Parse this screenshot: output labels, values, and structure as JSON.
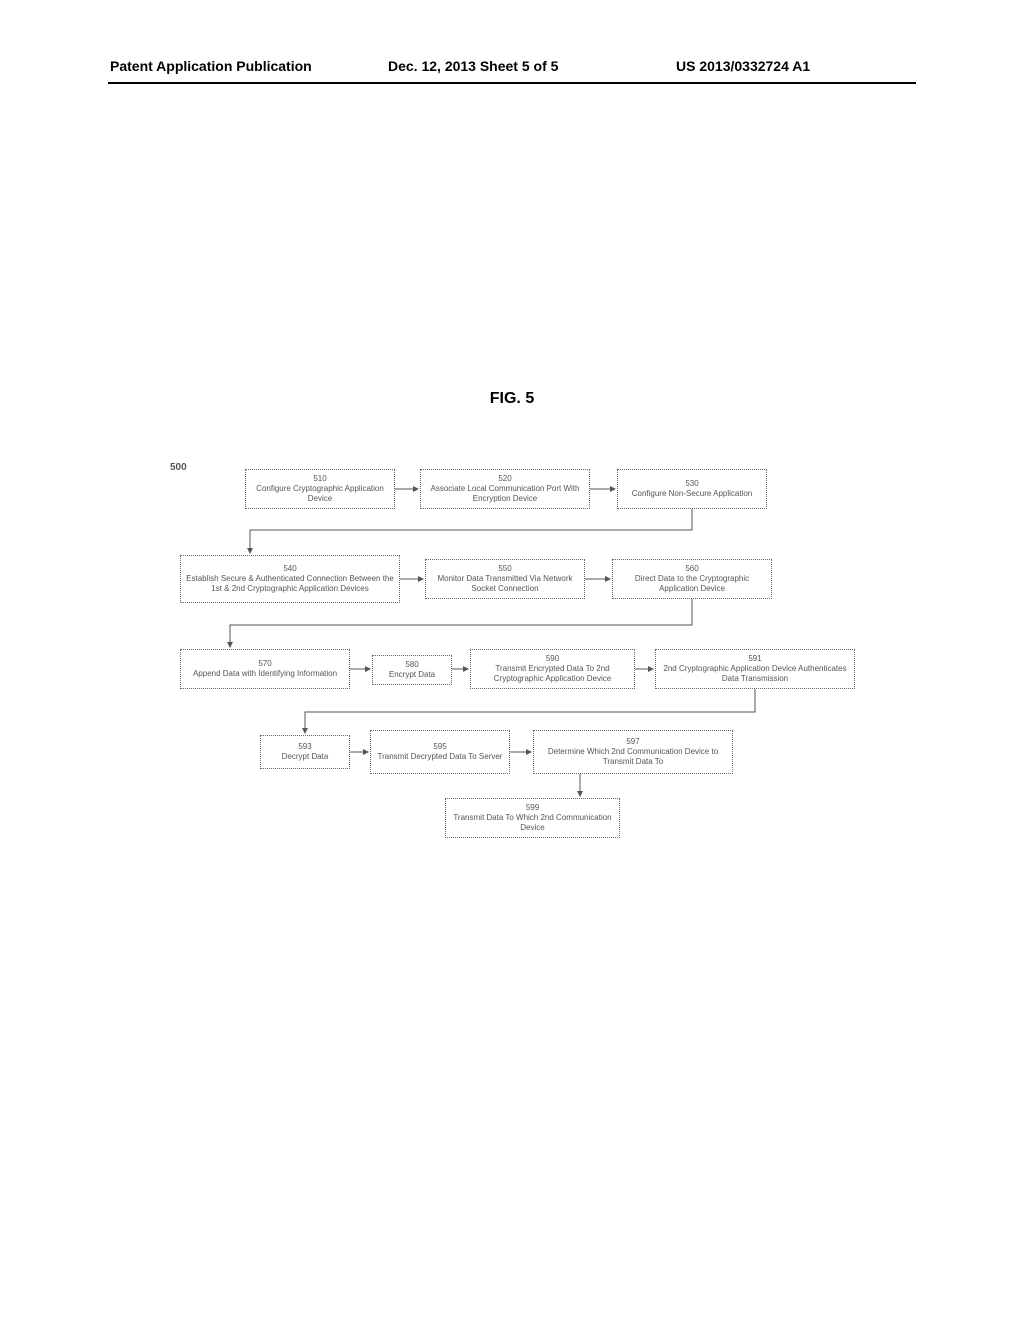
{
  "header": {
    "left": "Patent Application Publication",
    "mid": "Dec. 12, 2013  Sheet 5 of 5",
    "right": "US 2013/0332724 A1"
  },
  "figure_title": "FIG. 5",
  "ref_number": "500",
  "boxes": {
    "b510": {
      "num": "510",
      "text": "Configure Cryptographic Application Device"
    },
    "b520": {
      "num": "520",
      "text": "Associate Local Communication Port With Encryption Device"
    },
    "b530": {
      "num": "530",
      "text": "Configure Non-Secure Application"
    },
    "b540": {
      "num": "540",
      "text": "Establish Secure & Authenticated Connection Between the 1st & 2nd Cryptographic Application Devices"
    },
    "b550": {
      "num": "550",
      "text": "Monitor Data Transmitted Via Network Socket Connection"
    },
    "b560": {
      "num": "560",
      "text": "Direct Data to the Cryptographic Application Device"
    },
    "b570": {
      "num": "570",
      "text": "Append Data with Identifying Information"
    },
    "b580": {
      "num": "580",
      "text": "Encrypt Data"
    },
    "b590": {
      "num": "590",
      "text": "Transmit Encrypted Data To 2nd Cryptographic Application Device"
    },
    "b591": {
      "num": "591",
      "text": "2nd Cryptographic Application Device Authenticates Data Transmission"
    },
    "b593": {
      "num": "593",
      "text": "Decrypt Data"
    },
    "b595": {
      "num": "595",
      "text": "Transmit Decrypted Data To Server"
    },
    "b597": {
      "num": "597",
      "text": "Determine Which 2nd Communication Device to Transmit Data To"
    },
    "b599": {
      "num": "599",
      "text": "Transmit Data To Which 2nd Communication Device"
    }
  }
}
